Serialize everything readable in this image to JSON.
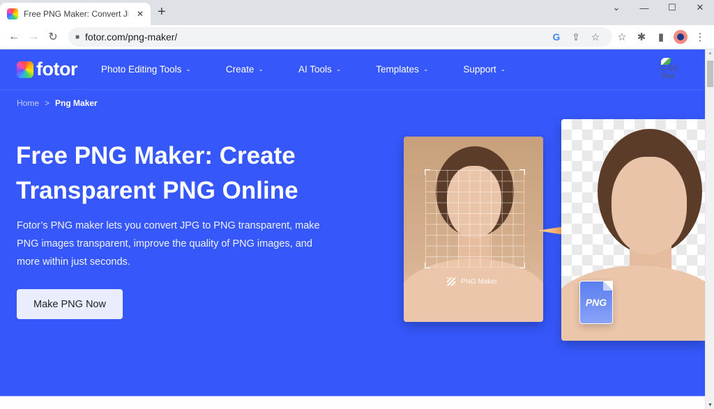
{
  "browser": {
    "tab_title": "Free PNG Maker: Convert JPG",
    "tab_close": "✕",
    "new_tab": "+",
    "url": "fotor.com/png-maker/",
    "window_controls": {
      "tab_search": "⌄",
      "minimize": "—",
      "maximize": "☐",
      "close": "✕"
    },
    "nav": {
      "back": "←",
      "forward": "→",
      "reload": "↻"
    },
    "omnibox_icons": {
      "google": "G",
      "share": "⇪",
      "bookmark": "☆"
    },
    "toolbar_icons": {
      "bookmarks": "☆",
      "extensions": "✱",
      "side_panel": "▮",
      "menu": "⋮"
    }
  },
  "site": {
    "logo_text": "fotor",
    "nav_items": [
      {
        "label": "Photo Editing Tools"
      },
      {
        "label": "Create"
      },
      {
        "label": "AI Tools"
      },
      {
        "label": "Templates"
      },
      {
        "label": "Support"
      }
    ],
    "chevron": "⌄",
    "avatar_alt": "C CV Tour"
  },
  "breadcrumb": {
    "home": "Home",
    "separator": ">",
    "current": "Png Maker"
  },
  "hero": {
    "title_line1": "Free PNG Maker: Create",
    "title_line2": "Transparent PNG Online",
    "description": "Fotor’s PNG maker lets you convert JPG to PNG transparent, make PNG images transparent, improve the quality of PNG images, and more within just seconds.",
    "cta_label": "Make PNG Now",
    "before_badge": "PNG Maker",
    "file_badge": "PNG"
  },
  "colors": {
    "brand_blue": "#3658fb",
    "arrow_orange": "#f7913a"
  }
}
